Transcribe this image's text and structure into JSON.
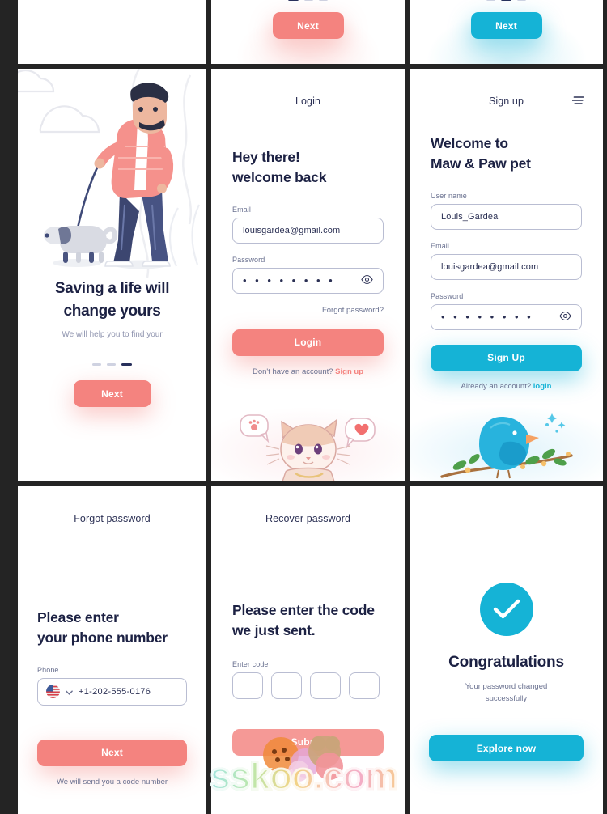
{
  "theme": {
    "coral": "#f4837f",
    "cyan": "#15b3d6",
    "navy": "#1c2143",
    "muted": "#6a7190",
    "border": "#b9bdd2",
    "page_bg": "#242424"
  },
  "cards": {
    "top_left": {
      "name": "blank-card"
    },
    "top_middle": {
      "next_label": "Next",
      "dots": [
        true,
        false,
        false
      ]
    },
    "top_right": {
      "next_label": "Next",
      "dots": [
        false,
        true,
        false
      ]
    },
    "onboarding": {
      "illustration": "man-walking-dog-illustration",
      "title_line1": "Saving a life will",
      "title_line2": "change yours",
      "subtitle": "We will help you to find your",
      "dots": [
        false,
        false,
        true
      ],
      "next_label": "Next"
    },
    "login": {
      "screen_title": "Login",
      "headline_line1": "Hey there!",
      "headline_line2": "welcome back",
      "email_label": "Email",
      "email_value": "louisgardea@gmail.com",
      "password_label": "Password",
      "password_value": "• • • • • • • •",
      "eye_icon": "eye-icon",
      "forgot_label": "Forgot password?",
      "login_button": "Login",
      "footer_prompt": "Don't have an account?",
      "footer_link": "Sign up",
      "illustration": "cat-with-speech-bubbles-illustration"
    },
    "signup": {
      "screen_title": "Sign up",
      "menu_icon": "filter-menu-icon",
      "headline_line1": "Welcome to",
      "headline_line2": "Maw & Paw pet",
      "username_label": "User name",
      "username_value": "Louis_Gardea",
      "email_label": "Email",
      "email_value": "louisgardea@gmail.com",
      "password_label": "Password",
      "password_value": "• • • • • • • •",
      "eye_icon": "eye-icon",
      "signup_button": "Sign Up",
      "footer_prompt": "Already an account?",
      "footer_link": "login",
      "illustration": "blue-bird-on-branch-illustration"
    },
    "forgot_password": {
      "screen_title": "Forgot password",
      "headline_line1": "Please enter",
      "headline_line2": "your phone number",
      "phone_label": "Phone",
      "flag_icon": "us-flag-icon",
      "chevron_icon": "chevron-down-icon",
      "phone_value": "+1-202-555-0176",
      "next_button": "Next",
      "helper_text": "We will send you a code number"
    },
    "recover_password": {
      "screen_title": "Recover password",
      "headline_line1": "Please enter the code",
      "headline_line2": "we just sent.",
      "code_label": "Enter code",
      "code_values": [
        "",
        "",
        "",
        ""
      ],
      "submit_button": "Submit"
    },
    "congratulations": {
      "check_icon": "check-circle-icon",
      "title": "Congratulations",
      "subtitle_line1": "Your password changed",
      "subtitle_line2": "successfully",
      "explore_button": "Explore now"
    }
  },
  "watermark": {
    "text": "sskoo.com"
  }
}
